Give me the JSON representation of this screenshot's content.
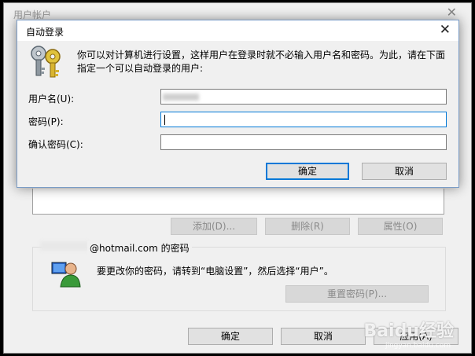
{
  "outer": {
    "title": "用户帐户",
    "buttons": {
      "add": "添加(D)...",
      "delete": "删除(R)",
      "properties": "属性(O)"
    },
    "group_label": "@hotmail.com 的密码",
    "group_text": "要更改你的密码，请转到“电脑设置”，然后选择“用户”。",
    "reset_password": "重置密码(P)...",
    "ok": "确定",
    "cancel": "取消",
    "apply": "应用(A)"
  },
  "dialog": {
    "title": "自动登录",
    "description": "你可以对计算机进行设置，这样用户在登录时就不必输入用户名和密码。为此，请在下面指定一个可以自动登录的用户:",
    "username_label": "用户名(U):",
    "password_label": "密码(P):",
    "confirm_label": "确认密码(C):",
    "ok": "确定",
    "cancel": "取消"
  },
  "icons": {
    "close": "close-icon",
    "key": "key-icon",
    "user": "user-icon"
  },
  "colors": {
    "focus_border": "#0078d7",
    "window_bg": "#f0f0f0"
  },
  "watermark": {
    "brand": "Baidu经验",
    "url": "jingyan.baidu.com"
  }
}
